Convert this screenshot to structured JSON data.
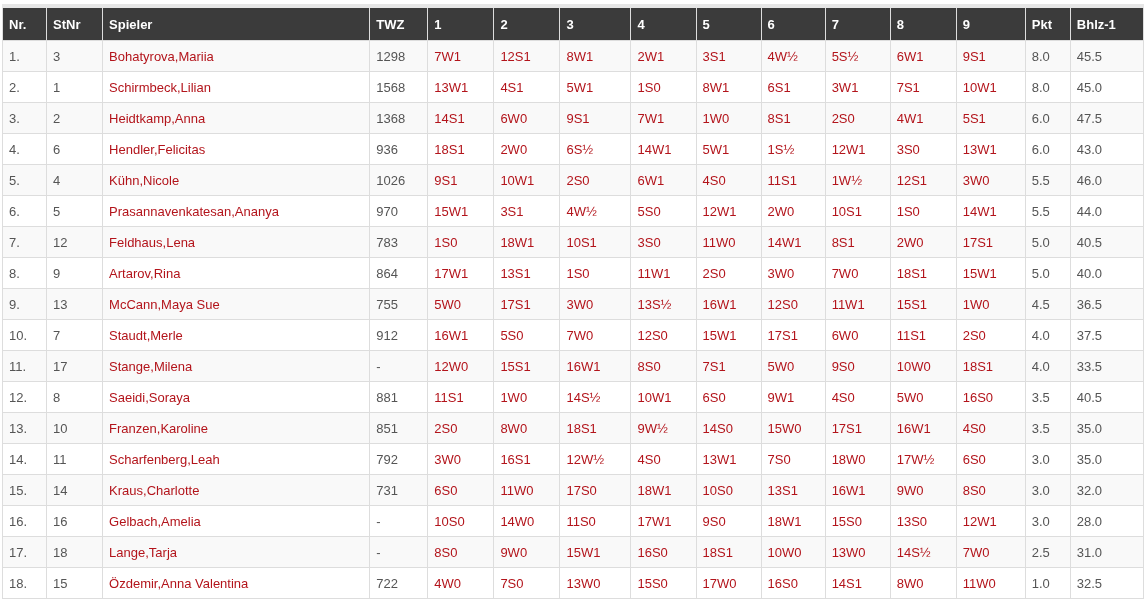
{
  "table": {
    "columns": [
      "Nr.",
      "StNr",
      "Spieler",
      "TWZ",
      "1",
      "2",
      "3",
      "4",
      "5",
      "6",
      "7",
      "8",
      "9",
      "Pkt",
      "Bhlz-1"
    ],
    "rows": [
      {
        "nr": "1.",
        "stnr": "3",
        "name": "Bohatyrova,Mariia",
        "twz": "1298",
        "rounds": [
          "7W1",
          "12S1",
          "8W1",
          "2W1",
          "3S1",
          "4W½",
          "5S½",
          "6W1",
          "9S1"
        ],
        "pkt": "8.0",
        "bhlz": "45.5"
      },
      {
        "nr": "2.",
        "stnr": "1",
        "name": "Schirmbeck,Lilian",
        "twz": "1568",
        "rounds": [
          "13W1",
          "4S1",
          "5W1",
          "1S0",
          "8W1",
          "6S1",
          "3W1",
          "7S1",
          "10W1"
        ],
        "pkt": "8.0",
        "bhlz": "45.0"
      },
      {
        "nr": "3.",
        "stnr": "2",
        "name": "Heidtkamp,Anna",
        "twz": "1368",
        "rounds": [
          "14S1",
          "6W0",
          "9S1",
          "7W1",
          "1W0",
          "8S1",
          "2S0",
          "4W1",
          "5S1"
        ],
        "pkt": "6.0",
        "bhlz": "47.5"
      },
      {
        "nr": "4.",
        "stnr": "6",
        "name": "Hendler,Felicitas",
        "twz": "936",
        "rounds": [
          "18S1",
          "2W0",
          "6S½",
          "14W1",
          "5W1",
          "1S½",
          "12W1",
          "3S0",
          "13W1"
        ],
        "pkt": "6.0",
        "bhlz": "43.0"
      },
      {
        "nr": "5.",
        "stnr": "4",
        "name": "Kühn,Nicole",
        "twz": "1026",
        "rounds": [
          "9S1",
          "10W1",
          "2S0",
          "6W1",
          "4S0",
          "11S1",
          "1W½",
          "12S1",
          "3W0"
        ],
        "pkt": "5.5",
        "bhlz": "46.0"
      },
      {
        "nr": "6.",
        "stnr": "5",
        "name": "Prasannavenkatesan,Ananya",
        "twz": "970",
        "rounds": [
          "15W1",
          "3S1",
          "4W½",
          "5S0",
          "12W1",
          "2W0",
          "10S1",
          "1S0",
          "14W1"
        ],
        "pkt": "5.5",
        "bhlz": "44.0"
      },
      {
        "nr": "7.",
        "stnr": "12",
        "name": "Feldhaus,Lena",
        "twz": "783",
        "rounds": [
          "1S0",
          "18W1",
          "10S1",
          "3S0",
          "11W0",
          "14W1",
          "8S1",
          "2W0",
          "17S1"
        ],
        "pkt": "5.0",
        "bhlz": "40.5"
      },
      {
        "nr": "8.",
        "stnr": "9",
        "name": "Artarov,Rina",
        "twz": "864",
        "rounds": [
          "17W1",
          "13S1",
          "1S0",
          "11W1",
          "2S0",
          "3W0",
          "7W0",
          "18S1",
          "15W1"
        ],
        "pkt": "5.0",
        "bhlz": "40.0"
      },
      {
        "nr": "9.",
        "stnr": "13",
        "name": "McCann,Maya Sue",
        "twz": "755",
        "rounds": [
          "5W0",
          "17S1",
          "3W0",
          "13S½",
          "16W1",
          "12S0",
          "11W1",
          "15S1",
          "1W0"
        ],
        "pkt": "4.5",
        "bhlz": "36.5"
      },
      {
        "nr": "10.",
        "stnr": "7",
        "name": "Staudt,Merle",
        "twz": "912",
        "rounds": [
          "16W1",
          "5S0",
          "7W0",
          "12S0",
          "15W1",
          "17S1",
          "6W0",
          "11S1",
          "2S0"
        ],
        "pkt": "4.0",
        "bhlz": "37.5"
      },
      {
        "nr": "11.",
        "stnr": "17",
        "name": "Stange,Milena",
        "twz": "-",
        "rounds": [
          "12W0",
          "15S1",
          "16W1",
          "8S0",
          "7S1",
          "5W0",
          "9S0",
          "10W0",
          "18S1"
        ],
        "pkt": "4.0",
        "bhlz": "33.5"
      },
      {
        "nr": "12.",
        "stnr": "8",
        "name": "Saeidi,Soraya",
        "twz": "881",
        "rounds": [
          "11S1",
          "1W0",
          "14S½",
          "10W1",
          "6S0",
          "9W1",
          "4S0",
          "5W0",
          "16S0"
        ],
        "pkt": "3.5",
        "bhlz": "40.5"
      },
      {
        "nr": "13.",
        "stnr": "10",
        "name": "Franzen,Karoline",
        "twz": "851",
        "rounds": [
          "2S0",
          "8W0",
          "18S1",
          "9W½",
          "14S0",
          "15W0",
          "17S1",
          "16W1",
          "4S0"
        ],
        "pkt": "3.5",
        "bhlz": "35.0"
      },
      {
        "nr": "14.",
        "stnr": "11",
        "name": "Scharfenberg,Leah",
        "twz": "792",
        "rounds": [
          "3W0",
          "16S1",
          "12W½",
          "4S0",
          "13W1",
          "7S0",
          "18W0",
          "17W½",
          "6S0"
        ],
        "pkt": "3.0",
        "bhlz": "35.0"
      },
      {
        "nr": "15.",
        "stnr": "14",
        "name": "Kraus,Charlotte",
        "twz": "731",
        "rounds": [
          "6S0",
          "11W0",
          "17S0",
          "18W1",
          "10S0",
          "13S1",
          "16W1",
          "9W0",
          "8S0"
        ],
        "pkt": "3.0",
        "bhlz": "32.0"
      },
      {
        "nr": "16.",
        "stnr": "16",
        "name": "Gelbach,Amelia",
        "twz": "-",
        "rounds": [
          "10S0",
          "14W0",
          "11S0",
          "17W1",
          "9S0",
          "18W1",
          "15S0",
          "13S0",
          "12W1"
        ],
        "pkt": "3.0",
        "bhlz": "28.0"
      },
      {
        "nr": "17.",
        "stnr": "18",
        "name": "Lange,Tarja",
        "twz": "-",
        "rounds": [
          "8S0",
          "9W0",
          "15W1",
          "16S0",
          "18S1",
          "10W0",
          "13W0",
          "14S½",
          "7W0"
        ],
        "pkt": "2.5",
        "bhlz": "31.0"
      },
      {
        "nr": "18.",
        "stnr": "15",
        "name": "Özdemir,Anna Valentina",
        "twz": "722",
        "rounds": [
          "4W0",
          "7S0",
          "13W0",
          "15S0",
          "17W0",
          "16S0",
          "14S1",
          "8W0",
          "11W0"
        ],
        "pkt": "1.0",
        "bhlz": "32.5"
      }
    ]
  }
}
